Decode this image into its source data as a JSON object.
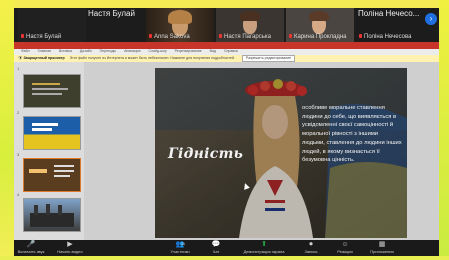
{
  "participants": [
    {
      "name": "Настя Булай",
      "muted": true
    },
    {
      "name": "Anna Sakova",
      "muted": true
    },
    {
      "name": "Настя Пагарська",
      "muted": true
    },
    {
      "name": "Карина Прокладна",
      "muted": true
    },
    {
      "name": "Поліна Нечесова",
      "muted": true
    }
  ],
  "big_names": {
    "left": "Настя Булай",
    "right": "Поліна Нечесо..."
  },
  "ribbon_tabs": [
    "Файл",
    "Главная",
    "Вставка",
    "Дизайн",
    "Переходы",
    "Анимация",
    "Слайд-шоу",
    "Рецензирование",
    "Вид",
    "Справка"
  ],
  "warning": {
    "label": "Защищенный просмотр",
    "text": "Этот файл получен из Интернета и может быть небезопасен. Нажмите для получения подробностей.",
    "button": "Разрешить редактирование"
  },
  "slides": [
    {
      "num": "1",
      "bg": "#3f3f2e"
    },
    {
      "num": "2",
      "bg": "#1c5fa8"
    },
    {
      "num": "3",
      "bg": "#5a3d1e"
    },
    {
      "num": "4",
      "bg": "#3d3d3d"
    }
  ],
  "slide": {
    "title": "Гідність",
    "body": "особливе моральне ставлення людини до себе, що виявляється в усвідомленні своєї самоцінності й моральної рівності з іншими людьми, ставлення до людини інших людей, в якому визнається її безумовна цінність."
  },
  "controls": [
    {
      "label": "Включить звук",
      "glyph": "🎤"
    },
    {
      "label": "Начать видео",
      "glyph": "▶"
    },
    {
      "label": "Участники",
      "glyph": "👥",
      "badge": "11"
    },
    {
      "label": "Чат",
      "glyph": "💬"
    },
    {
      "label": "Демонстрация экрана",
      "glyph": "⬆"
    },
    {
      "label": "Запись",
      "glyph": "⏺"
    },
    {
      "label": "Реакции",
      "glyph": "☺"
    },
    {
      "label": "Приложения",
      "glyph": "▦"
    }
  ],
  "colors": {
    "accent": "#1f6fe0",
    "ribbon": "#c7342a",
    "share": "#2aa84a"
  }
}
